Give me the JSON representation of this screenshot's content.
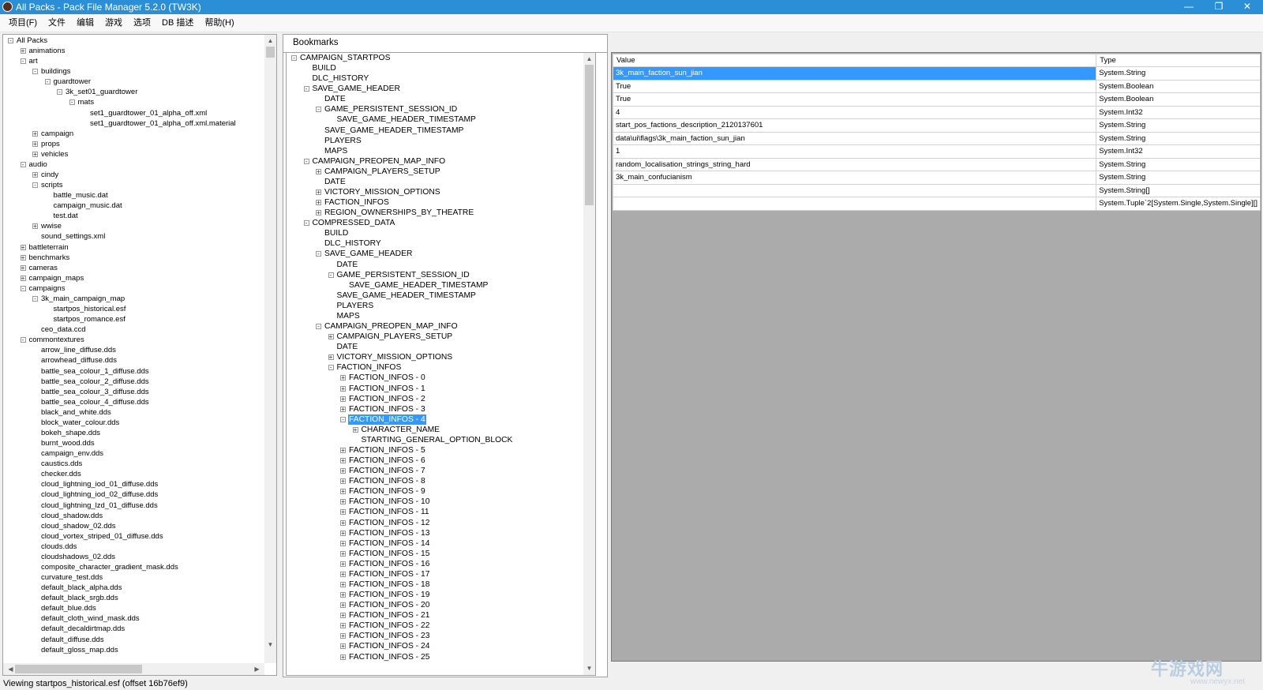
{
  "window": {
    "title": "All Packs - Pack File Manager 5.2.0 (TW3K)",
    "minimize": "—",
    "maximize": "❐",
    "close": "✕"
  },
  "menu": [
    "项目(F)",
    "文件",
    "编辑",
    "游戏",
    "选项",
    "DB 描述",
    "帮助(H)"
  ],
  "left_tree": [
    {
      "d": 0,
      "e": "-",
      "t": "All Packs"
    },
    {
      "d": 1,
      "e": "+",
      "t": "animations"
    },
    {
      "d": 1,
      "e": "-",
      "t": "art"
    },
    {
      "d": 2,
      "e": "-",
      "t": "buildings"
    },
    {
      "d": 3,
      "e": "-",
      "t": "guardtower"
    },
    {
      "d": 4,
      "e": "-",
      "t": "3k_set01_guardtower"
    },
    {
      "d": 5,
      "e": "-",
      "t": "mats"
    },
    {
      "d": 6,
      "e": "",
      "t": "set1_guardtower_01_alpha_off.xml"
    },
    {
      "d": 6,
      "e": "",
      "t": "set1_guardtower_01_alpha_off.xml.material"
    },
    {
      "d": 2,
      "e": "+",
      "t": "campaign"
    },
    {
      "d": 2,
      "e": "+",
      "t": "props"
    },
    {
      "d": 2,
      "e": "+",
      "t": "vehicles"
    },
    {
      "d": 1,
      "e": "-",
      "t": "audio"
    },
    {
      "d": 2,
      "e": "+",
      "t": "cindy"
    },
    {
      "d": 2,
      "e": "-",
      "t": "scripts"
    },
    {
      "d": 3,
      "e": "",
      "t": "battle_music.dat"
    },
    {
      "d": 3,
      "e": "",
      "t": "campaign_music.dat"
    },
    {
      "d": 3,
      "e": "",
      "t": "test.dat"
    },
    {
      "d": 2,
      "e": "+",
      "t": "wwise"
    },
    {
      "d": 2,
      "e": "",
      "t": "sound_settings.xml"
    },
    {
      "d": 1,
      "e": "+",
      "t": "battleterrain"
    },
    {
      "d": 1,
      "e": "+",
      "t": "benchmarks"
    },
    {
      "d": 1,
      "e": "+",
      "t": "cameras"
    },
    {
      "d": 1,
      "e": "+",
      "t": "campaign_maps"
    },
    {
      "d": 1,
      "e": "-",
      "t": "campaigns"
    },
    {
      "d": 2,
      "e": "-",
      "t": "3k_main_campaign_map"
    },
    {
      "d": 3,
      "e": "",
      "t": "startpos_historical.esf"
    },
    {
      "d": 3,
      "e": "",
      "t": "startpos_romance.esf"
    },
    {
      "d": 2,
      "e": "",
      "t": "ceo_data.ccd"
    },
    {
      "d": 1,
      "e": "-",
      "t": "commontextures"
    },
    {
      "d": 2,
      "e": "",
      "t": "arrow_line_diffuse.dds"
    },
    {
      "d": 2,
      "e": "",
      "t": "arrowhead_diffuse.dds"
    },
    {
      "d": 2,
      "e": "",
      "t": "battle_sea_colour_1_diffuse.dds"
    },
    {
      "d": 2,
      "e": "",
      "t": "battle_sea_colour_2_diffuse.dds"
    },
    {
      "d": 2,
      "e": "",
      "t": "battle_sea_colour_3_diffuse.dds"
    },
    {
      "d": 2,
      "e": "",
      "t": "battle_sea_colour_4_diffuse.dds"
    },
    {
      "d": 2,
      "e": "",
      "t": "black_and_white.dds"
    },
    {
      "d": 2,
      "e": "",
      "t": "block_water_colour.dds"
    },
    {
      "d": 2,
      "e": "",
      "t": "bokeh_shape.dds"
    },
    {
      "d": 2,
      "e": "",
      "t": "burnt_wood.dds"
    },
    {
      "d": 2,
      "e": "",
      "t": "campaign_env.dds"
    },
    {
      "d": 2,
      "e": "",
      "t": "caustics.dds"
    },
    {
      "d": 2,
      "e": "",
      "t": "checker.dds"
    },
    {
      "d": 2,
      "e": "",
      "t": "cloud_lightning_iod_01_diffuse.dds"
    },
    {
      "d": 2,
      "e": "",
      "t": "cloud_lightning_iod_02_diffuse.dds"
    },
    {
      "d": 2,
      "e": "",
      "t": "cloud_lightning_lzd_01_diffuse.dds"
    },
    {
      "d": 2,
      "e": "",
      "t": "cloud_shadow.dds"
    },
    {
      "d": 2,
      "e": "",
      "t": "cloud_shadow_02.dds"
    },
    {
      "d": 2,
      "e": "",
      "t": "cloud_vortex_striped_01_diffuse.dds"
    },
    {
      "d": 2,
      "e": "",
      "t": "clouds.dds"
    },
    {
      "d": 2,
      "e": "",
      "t": "cloudshadows_02.dds"
    },
    {
      "d": 2,
      "e": "",
      "t": "composite_character_gradient_mask.dds"
    },
    {
      "d": 2,
      "e": "",
      "t": "curvature_test.dds"
    },
    {
      "d": 2,
      "e": "",
      "t": "default_black_alpha.dds"
    },
    {
      "d": 2,
      "e": "",
      "t": "default_black_srgb.dds"
    },
    {
      "d": 2,
      "e": "",
      "t": "default_blue.dds"
    },
    {
      "d": 2,
      "e": "",
      "t": "default_cloth_wind_mask.dds"
    },
    {
      "d": 2,
      "e": "",
      "t": "default_decaldirtmap.dds"
    },
    {
      "d": 2,
      "e": "",
      "t": "default_diffuse.dds"
    },
    {
      "d": 2,
      "e": "",
      "t": "default_gloss_map.dds"
    }
  ],
  "bookmarks_label": "Bookmarks",
  "mid_tree": [
    {
      "d": 0,
      "e": "-",
      "t": "CAMPAIGN_STARTPOS"
    },
    {
      "d": 1,
      "e": "",
      "t": "BUILD"
    },
    {
      "d": 1,
      "e": "",
      "t": "DLC_HISTORY"
    },
    {
      "d": 1,
      "e": "-",
      "t": "SAVE_GAME_HEADER"
    },
    {
      "d": 2,
      "e": "",
      "t": "DATE"
    },
    {
      "d": 2,
      "e": "-",
      "t": "GAME_PERSISTENT_SESSION_ID"
    },
    {
      "d": 3,
      "e": "",
      "t": "SAVE_GAME_HEADER_TIMESTAMP"
    },
    {
      "d": 2,
      "e": "",
      "t": "SAVE_GAME_HEADER_TIMESTAMP"
    },
    {
      "d": 2,
      "e": "",
      "t": "PLAYERS"
    },
    {
      "d": 2,
      "e": "",
      "t": "MAPS"
    },
    {
      "d": 1,
      "e": "-",
      "t": "CAMPAIGN_PREOPEN_MAP_INFO"
    },
    {
      "d": 2,
      "e": "+",
      "t": "CAMPAIGN_PLAYERS_SETUP"
    },
    {
      "d": 2,
      "e": "",
      "t": "DATE"
    },
    {
      "d": 2,
      "e": "+",
      "t": "VICTORY_MISSION_OPTIONS"
    },
    {
      "d": 2,
      "e": "+",
      "t": "FACTION_INFOS"
    },
    {
      "d": 2,
      "e": "+",
      "t": "REGION_OWNERSHIPS_BY_THEATRE"
    },
    {
      "d": 1,
      "e": "-",
      "t": "COMPRESSED_DATA"
    },
    {
      "d": 2,
      "e": "",
      "t": "BUILD"
    },
    {
      "d": 2,
      "e": "",
      "t": "DLC_HISTORY"
    },
    {
      "d": 2,
      "e": "-",
      "t": "SAVE_GAME_HEADER"
    },
    {
      "d": 3,
      "e": "",
      "t": "DATE"
    },
    {
      "d": 3,
      "e": "-",
      "t": "GAME_PERSISTENT_SESSION_ID"
    },
    {
      "d": 4,
      "e": "",
      "t": "SAVE_GAME_HEADER_TIMESTAMP"
    },
    {
      "d": 3,
      "e": "",
      "t": "SAVE_GAME_HEADER_TIMESTAMP"
    },
    {
      "d": 3,
      "e": "",
      "t": "PLAYERS"
    },
    {
      "d": 3,
      "e": "",
      "t": "MAPS"
    },
    {
      "d": 2,
      "e": "-",
      "t": "CAMPAIGN_PREOPEN_MAP_INFO"
    },
    {
      "d": 3,
      "e": "+",
      "t": "CAMPAIGN_PLAYERS_SETUP"
    },
    {
      "d": 3,
      "e": "",
      "t": "DATE"
    },
    {
      "d": 3,
      "e": "+",
      "t": "VICTORY_MISSION_OPTIONS"
    },
    {
      "d": 3,
      "e": "-",
      "t": "FACTION_INFOS"
    },
    {
      "d": 4,
      "e": "+",
      "t": "FACTION_INFOS - 0"
    },
    {
      "d": 4,
      "e": "+",
      "t": "FACTION_INFOS - 1"
    },
    {
      "d": 4,
      "e": "+",
      "t": "FACTION_INFOS - 2"
    },
    {
      "d": 4,
      "e": "+",
      "t": "FACTION_INFOS - 3"
    },
    {
      "d": 4,
      "e": "-",
      "t": "FACTION_INFOS - 4",
      "sel": true
    },
    {
      "d": 5,
      "e": "+",
      "t": "CHARACTER_NAME"
    },
    {
      "d": 5,
      "e": "",
      "t": "STARTING_GENERAL_OPTION_BLOCK"
    },
    {
      "d": 4,
      "e": "+",
      "t": "FACTION_INFOS - 5"
    },
    {
      "d": 4,
      "e": "+",
      "t": "FACTION_INFOS - 6"
    },
    {
      "d": 4,
      "e": "+",
      "t": "FACTION_INFOS - 7"
    },
    {
      "d": 4,
      "e": "+",
      "t": "FACTION_INFOS - 8"
    },
    {
      "d": 4,
      "e": "+",
      "t": "FACTION_INFOS - 9"
    },
    {
      "d": 4,
      "e": "+",
      "t": "FACTION_INFOS - 10"
    },
    {
      "d": 4,
      "e": "+",
      "t": "FACTION_INFOS - 11"
    },
    {
      "d": 4,
      "e": "+",
      "t": "FACTION_INFOS - 12"
    },
    {
      "d": 4,
      "e": "+",
      "t": "FACTION_INFOS - 13"
    },
    {
      "d": 4,
      "e": "+",
      "t": "FACTION_INFOS - 14"
    },
    {
      "d": 4,
      "e": "+",
      "t": "FACTION_INFOS - 15"
    },
    {
      "d": 4,
      "e": "+",
      "t": "FACTION_INFOS - 16"
    },
    {
      "d": 4,
      "e": "+",
      "t": "FACTION_INFOS - 17"
    },
    {
      "d": 4,
      "e": "+",
      "t": "FACTION_INFOS - 18"
    },
    {
      "d": 4,
      "e": "+",
      "t": "FACTION_INFOS - 19"
    },
    {
      "d": 4,
      "e": "+",
      "t": "FACTION_INFOS - 20"
    },
    {
      "d": 4,
      "e": "+",
      "t": "FACTION_INFOS - 21"
    },
    {
      "d": 4,
      "e": "+",
      "t": "FACTION_INFOS - 22"
    },
    {
      "d": 4,
      "e": "+",
      "t": "FACTION_INFOS - 23"
    },
    {
      "d": 4,
      "e": "+",
      "t": "FACTION_INFOS - 24"
    },
    {
      "d": 4,
      "e": "+",
      "t": "FACTION_INFOS - 25"
    }
  ],
  "grid": {
    "headers": {
      "value": "Value",
      "type": "Type"
    },
    "rows": [
      {
        "value": "3k_main_faction_sun_jian",
        "type": "System.String",
        "sel": true
      },
      {
        "value": "True",
        "type": "System.Boolean"
      },
      {
        "value": "True",
        "type": "System.Boolean"
      },
      {
        "value": "4",
        "type": "System.Int32"
      },
      {
        "value": "start_pos_factions_description_2120137601",
        "type": "System.String"
      },
      {
        "value": "data\\ui\\flags\\3k_main_faction_sun_jian",
        "type": "System.String"
      },
      {
        "value": "1",
        "type": "System.Int32"
      },
      {
        "value": "random_localisation_strings_string_hard",
        "type": "System.String"
      },
      {
        "value": "3k_main_confucianism",
        "type": "System.String"
      },
      {
        "value": "",
        "type": "System.String[]"
      },
      {
        "value": "",
        "type": "System.Tuple`2[System.Single,System.Single][]"
      }
    ]
  },
  "status": "Viewing startpos_historical.esf (offset 16b76ef9)",
  "watermark": {
    "text": "牛游戏网",
    "url": "www.newyx.net"
  },
  "colors": {
    "titlebar": "#2b8fd8",
    "selection": "#3399ff",
    "grid_empty": "#ababab"
  }
}
